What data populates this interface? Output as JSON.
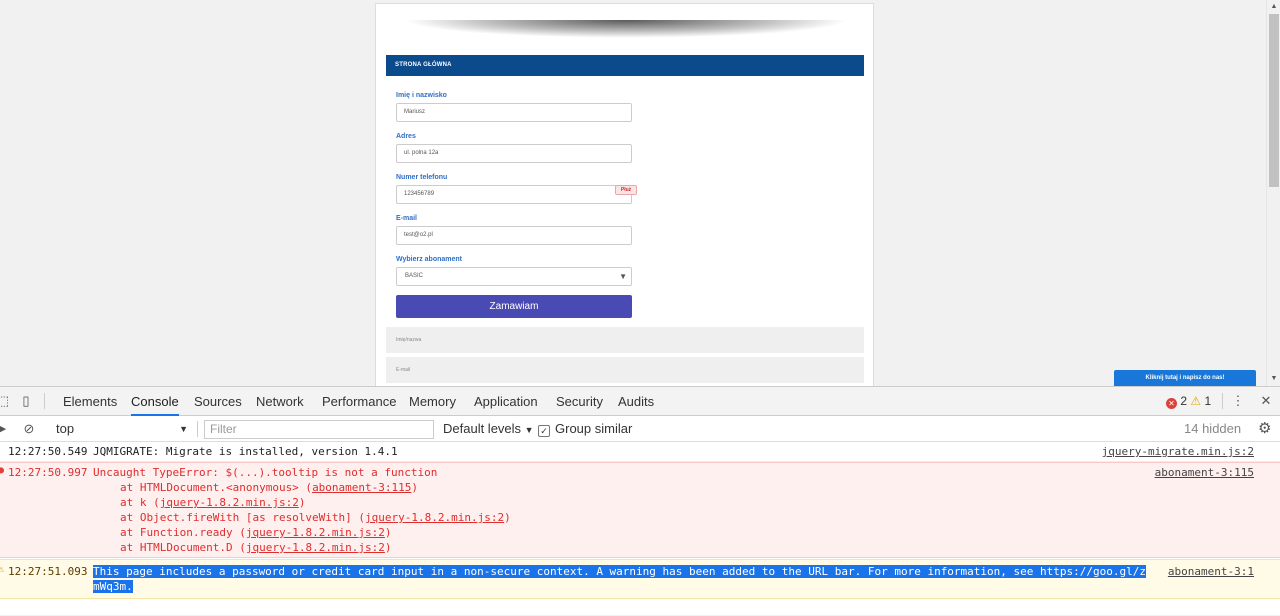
{
  "page": {
    "nav_title": "STRONA GŁÓWNA",
    "form": {
      "fields": [
        {
          "label": "Imię i nazwisko",
          "value": "Mariusz"
        },
        {
          "label": "Adres",
          "value": "ul. polna 12a"
        },
        {
          "label": "Numer telefonu",
          "value": "123456789",
          "badge": "Płuż"
        },
        {
          "label": "E-mail",
          "value": "test@o2.pl"
        }
      ],
      "select": {
        "label": "Wybierz abonament",
        "value": "BASIC"
      },
      "submit_label": "Zamawiam"
    },
    "lower_blocks": [
      "Imię/nazwa",
      "E-mail"
    ],
    "chat_widget": "Kliknij tutaj i napisz do nas!"
  },
  "devtools": {
    "tabs": [
      "Elements",
      "Console",
      "Sources",
      "Network",
      "Performance",
      "Memory",
      "Application",
      "Security",
      "Audits"
    ],
    "active_tab": "Console",
    "error_count": "2",
    "warning_count": "1",
    "toolbar": {
      "context": "top",
      "filter_placeholder": "Filter",
      "levels": "Default levels",
      "group_similar": "Group similar",
      "hidden": "14 hidden"
    },
    "messages": {
      "log": {
        "time": "12:27:50.549",
        "text": "JQMIGRATE: Migrate is installed, version 1.4.1",
        "source": "jquery-migrate.min.js:2"
      },
      "error": {
        "time": "12:27:50.997",
        "text": "Uncaught TypeError: $(...).tooltip is not a function",
        "source": "abonament-3:115",
        "stack": [
          {
            "prefix": "at HTMLDocument.<anonymous> (",
            "link": "abonament-3:115",
            "suffix": ")"
          },
          {
            "prefix": "at k (",
            "link": "jquery-1.8.2.min.js:2",
            "suffix": ")"
          },
          {
            "prefix": "at Object.fireWith [as resolveWith] (",
            "link": "jquery-1.8.2.min.js:2",
            "suffix": ")"
          },
          {
            "prefix": "at Function.ready (",
            "link": "jquery-1.8.2.min.js:2",
            "suffix": ")"
          },
          {
            "prefix": "at HTMLDocument.D (",
            "link": "jquery-1.8.2.min.js:2",
            "suffix": ")"
          }
        ]
      },
      "warning": {
        "time": "12:27:51.093",
        "line1": "This page includes a password or credit card input in a non-secure context. A warning has been added to the URL bar. For more information, see https://goo.gl/z",
        "line2": "mWq3m.",
        "source": "abonament-3:1"
      }
    }
  }
}
